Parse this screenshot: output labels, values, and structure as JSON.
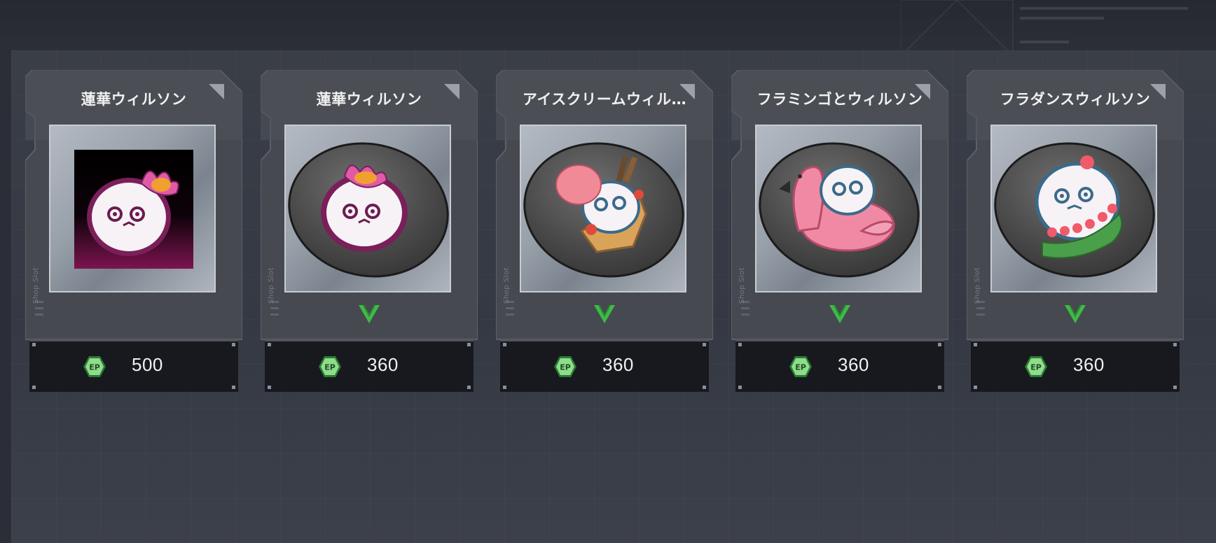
{
  "colors": {
    "accent_green": "#3dbb45",
    "ep_badge_fill": "#8fdc8a",
    "title_text": "#f1f1f1",
    "price_bar": "#17191e"
  },
  "shop": {
    "slot_label": "Shop Slot",
    "items": [
      {
        "title": "蓮華ウィルソン",
        "price": "500",
        "currency": "EP",
        "image": "lotus-wilson-icon",
        "owned_check": false
      },
      {
        "title": "蓮華ウィルソン",
        "price": "360",
        "currency": "EP",
        "image": "lotus-wilson-badge",
        "owned_check": true
      },
      {
        "title": "アイスクリームウィル…",
        "price": "360",
        "currency": "EP",
        "image": "icecream-wilson-badge",
        "owned_check": true
      },
      {
        "title": "フラミンゴとウィルソン",
        "price": "360",
        "currency": "EP",
        "image": "flamingo-wilson-badge",
        "owned_check": true
      },
      {
        "title": "フラダンスウィルソン",
        "price": "360",
        "currency": "EP",
        "image": "hula-wilson-badge",
        "owned_check": true
      }
    ]
  }
}
